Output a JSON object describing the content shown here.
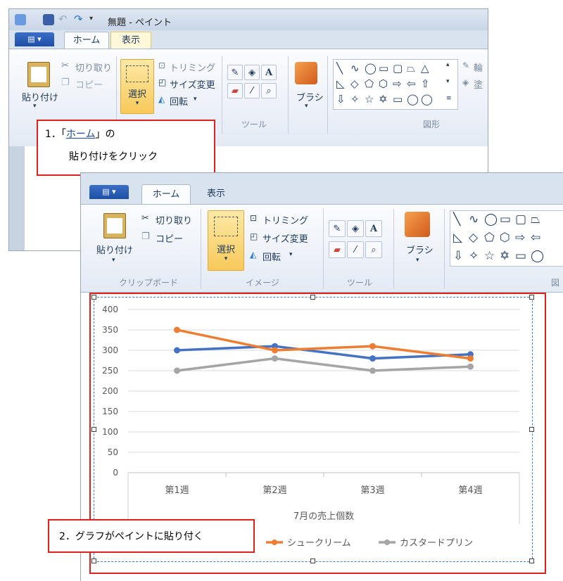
{
  "back_window": {
    "title": "無題 - ペイント",
    "tabs": [
      "ホーム",
      "表示"
    ],
    "clipboard": {
      "paste_label": "貼り付け",
      "cut_label": "切り取り",
      "copy_label": "コピー"
    },
    "image": {
      "select_label": "選択",
      "trim_label": "トリミング",
      "resize_label": "サイズ変更",
      "rotate_label": "回転"
    },
    "tools_group_label": "ツール",
    "brush_label": "ブラシ",
    "shapes_group_label": "図形",
    "clipped_labels": [
      "輪",
      "塗"
    ]
  },
  "front_window": {
    "tabs": [
      "ホーム",
      "表示"
    ],
    "clipboard": {
      "paste_label": "貼り付け",
      "cut_label": "切り取り",
      "copy_label": "コピー",
      "group_label": "クリップボード"
    },
    "image": {
      "select_label": "選択",
      "trim_label": "トリミング",
      "resize_label": "サイズ変更",
      "rotate_label": "回転",
      "group_label": "イメージ"
    },
    "tools_group_label": "ツール",
    "brush_label": "ブラシ",
    "shapes_group_label_partial": "図"
  },
  "callouts": {
    "step1_line1_prefix": "1．「",
    "step1_line1_link": "ホーム",
    "step1_line1_suffix": "」の",
    "step1_line2": "貼り付けをクリック",
    "step2": "2．グラフがペイントに貼り付く"
  },
  "colors": {
    "accent_red": "#e0201c",
    "series_blue": "#4472c4",
    "series_orange": "#ed7d31",
    "series_gray": "#a5a5a5"
  },
  "chart_data": {
    "type": "line",
    "categories": [
      "第1週",
      "第2週",
      "第3週",
      "第4週"
    ],
    "series": [
      {
        "name": "",
        "color": "#4472c4",
        "values": [
          300,
          310,
          280,
          290
        ]
      },
      {
        "name": "シュークリーム",
        "color": "#ed7d31",
        "values": [
          350,
          300,
          310,
          280
        ]
      },
      {
        "name": "カスタードプリン",
        "color": "#a5a5a5",
        "values": [
          250,
          280,
          250,
          260
        ]
      }
    ],
    "yticks": [
      "400",
      "350",
      "300",
      "250",
      "200",
      "150",
      "100",
      "50",
      "0"
    ],
    "ylim": [
      0,
      400
    ],
    "xlabel": "7月の売上個数",
    "grid": true,
    "legend": "bottom"
  }
}
